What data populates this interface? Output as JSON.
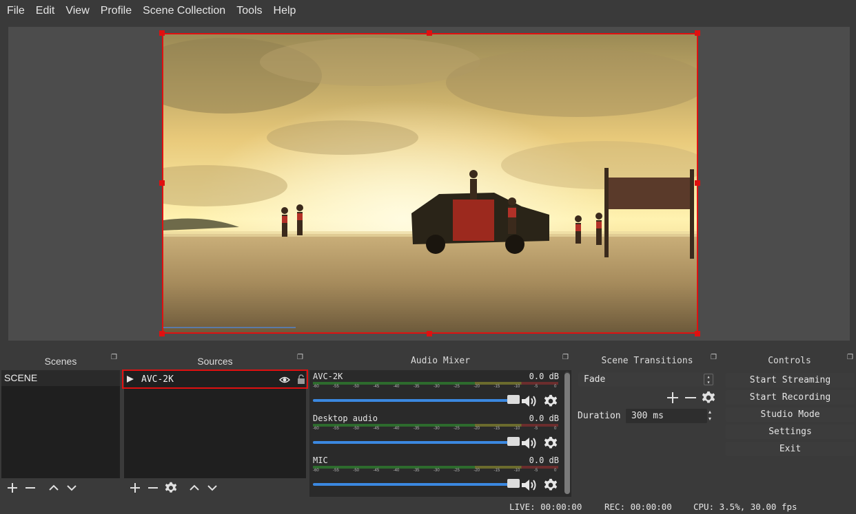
{
  "menu": [
    "File",
    "Edit",
    "View",
    "Profile",
    "Scene Collection",
    "Tools",
    "Help"
  ],
  "docks": {
    "scenes": {
      "title": "Scenes",
      "items": [
        "SCENE"
      ]
    },
    "sources": {
      "title": "Sources",
      "items": [
        {
          "name": "AVC-2K",
          "visible": true,
          "locked": false
        }
      ]
    },
    "mixer": {
      "title": "Audio Mixer",
      "channels": [
        {
          "name": "AVC-2K",
          "db": "0.0 dB",
          "volume": 1.0
        },
        {
          "name": "Desktop audio",
          "db": "0.0 dB",
          "volume": 1.0
        },
        {
          "name": "MIC",
          "db": "0.0 dB",
          "volume": 1.0
        }
      ],
      "ticks": [
        "-60",
        "-55",
        "-50",
        "-45",
        "-40",
        "-35",
        "-30",
        "-25",
        "-20",
        "-15",
        "-10",
        "-5",
        "0"
      ]
    },
    "transitions": {
      "title": "Scene Transitions",
      "selected": "Fade",
      "duration_label": "Duration",
      "duration_value": "300 ms"
    },
    "controls": {
      "title": "Controls",
      "buttons": [
        "Start Streaming",
        "Start Recording",
        "Studio Mode",
        "Settings",
        "Exit"
      ]
    }
  },
  "status": {
    "live": "LIVE: 00:00:00",
    "rec": "REC: 00:00:00",
    "cpu": "CPU: 3.5%, 30.00 fps"
  },
  "colors": {
    "selection": "#e01010",
    "fader": "#3b88e0",
    "panel": "#3a3a3a",
    "dock_body": "#1f1f1f"
  }
}
